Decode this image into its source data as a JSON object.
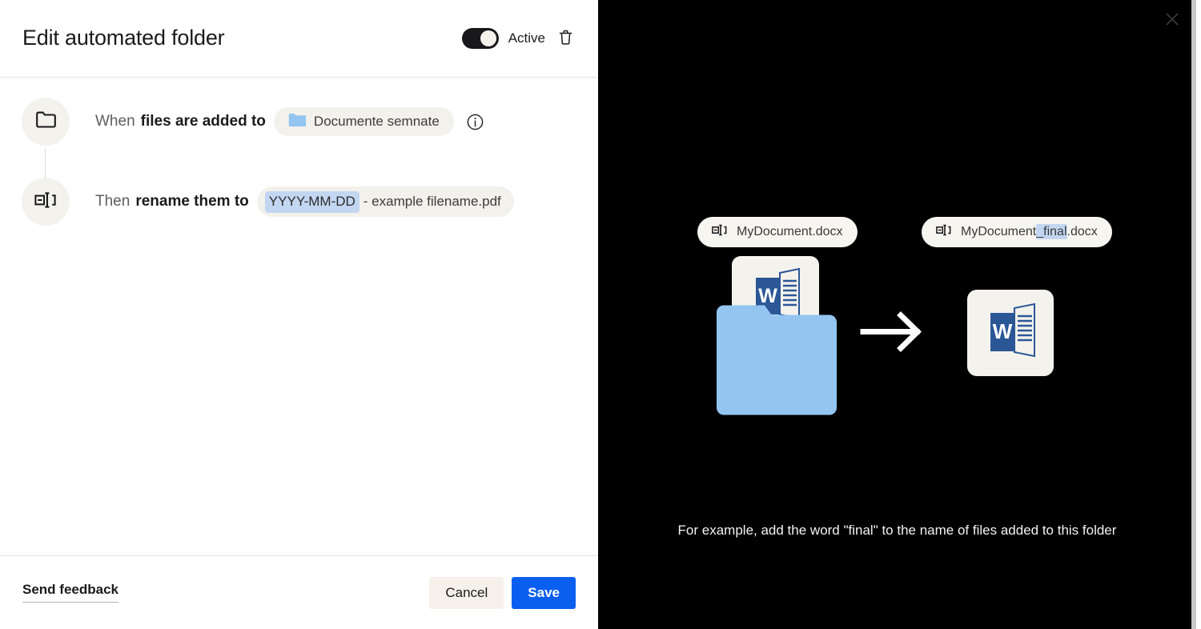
{
  "dialog": {
    "title": "Edit automated folder",
    "toggle": {
      "label": "Active",
      "state": "on",
      "icon": "toggle-switch-icon"
    },
    "delete_icon": "trash-icon",
    "close_icon": "close-icon"
  },
  "rules": [
    {
      "step_icon": "folder-icon",
      "prefix": "When",
      "strong": "files are added to",
      "chip": {
        "icon": "folder-icon",
        "label": "Documente semnate"
      },
      "info_icon": "info-icon"
    },
    {
      "step_icon": "rename-icon",
      "prefix": "Then",
      "strong": "rename them to",
      "chip": {
        "token": "YYYY-MM-DD",
        "tail": "- example filename.pdf"
      }
    }
  ],
  "footer": {
    "feedback_label": "Send feedback",
    "cancel_label": "Cancel",
    "save_label": "Save"
  },
  "preview": {
    "pill_before": {
      "icon": "rename-icon",
      "label": "MyDocument.docx"
    },
    "pill_after": {
      "icon": "rename-icon",
      "label_prefix": "MyDocument",
      "label_highlight": "_final",
      "label_suffix": ".docx"
    },
    "arrow_icon": "arrow-right-icon",
    "folder_icon": "folder-illustration",
    "document_icon": "word-document-icon",
    "caption": "For example, add the word \"final\" to the name of files added to this folder"
  },
  "colors": {
    "accent_blue": "#0b5fef",
    "folder_blue": "#93c5f0",
    "chip_cream": "#f3f1ec",
    "highlight_blue": "#c3d6f1",
    "word_blue": "#2b5797",
    "panel_black": "#000000"
  }
}
